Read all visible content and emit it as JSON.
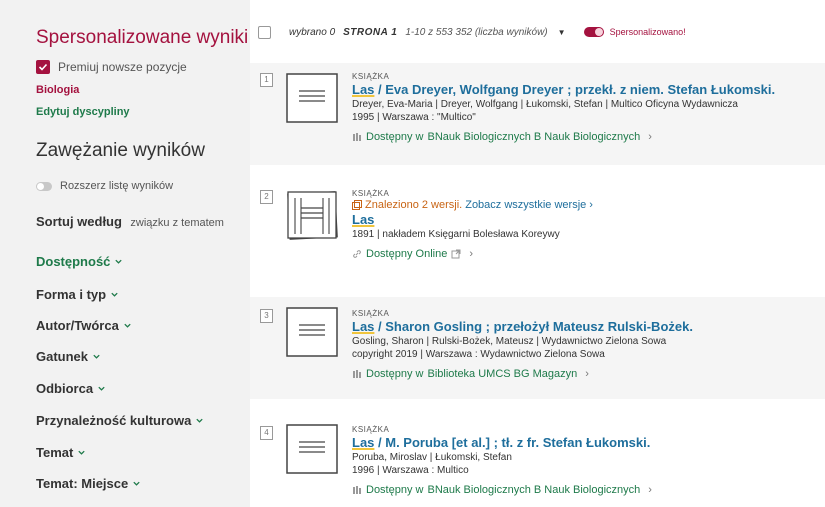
{
  "sidebar": {
    "personalized_title": "Spersonalizowane wyniki",
    "reward_new_label": "Premiuj nowsze pozycje",
    "discipline_selected": "Biologia",
    "edit_disciplines_label": "Edytuj dyscypliny",
    "narrow_title": "Zawężanie wyników",
    "expand_list_label": "Rozszerz listę wyników",
    "sort_label": "Sortuj według",
    "sort_value": "związku z tematem",
    "facets": [
      {
        "label": "Dostępność"
      },
      {
        "label": "Forma i typ"
      },
      {
        "label": "Autor/Twórca"
      },
      {
        "label": "Gatunek"
      },
      {
        "label": "Odbiorca"
      },
      {
        "label": "Przynależność kulturowa"
      },
      {
        "label": "Temat"
      },
      {
        "label": "Temat: Miejsce"
      }
    ]
  },
  "toolbar": {
    "selected": "wybrano 0",
    "page": "STRONA 1",
    "range": "1-10 z 553 352 (liczba wyników)",
    "personalized_label": "Spersonalizowano!"
  },
  "results": [
    {
      "number": "1",
      "type": "KSIĄŻKA",
      "title_first": "Las",
      "title_rest": " / Eva Dreyer, Wolfgang Dreyer ; przekł. z niem. Stefan Łukomski.",
      "authors": "Dreyer, Eva-Maria | Dreyer, Wolfgang | Łukomski, Stefan | Multico Oficyna Wydawnicza",
      "publication": "1995 | Warszawa : \"Multico\"",
      "availability": "Dostępny w",
      "location": "BNauk Biologicznych  B Nauk Biologicznych",
      "icon": "book-icon"
    },
    {
      "number": "2",
      "type": "KSIĄŻKA",
      "versions_found": "Znaleziono 2 wersji.",
      "versions_link": "Zobacz wszystkie wersje",
      "title_first": "Las",
      "title_rest": "",
      "publication": "1891 | nakładem Księgarni Bolesława Koreywy",
      "availability": "Dostępny Online",
      "icon": "multiple-versions-icon"
    },
    {
      "number": "3",
      "type": "KSIĄŻKA",
      "title_first": "Las",
      "title_rest": " / Sharon Gosling ; przełożył Mateusz Rulski-Bożek.",
      "authors": "Gosling, Sharon | Rulski-Bożek, Mateusz | Wydawnictwo Zielona Sowa",
      "publication": "copyright 2019 | Warszawa : Wydawnictwo Zielona Sowa",
      "availability": "Dostępny w",
      "location": "Biblioteka UMCS  BG Magazyn",
      "icon": "book-icon"
    },
    {
      "number": "4",
      "type": "KSIĄŻKA",
      "title_first": "Las",
      "title_rest": " / M. Poruba [et al.] ; tł. z fr. Stefan Łukomski.",
      "authors": "Poruba, Miroslav | Łukomski, Stefan",
      "publication": "1996 | Warszawa : Multico",
      "availability": "Dostępny w",
      "location": "BNauk Biologicznych  B Nauk Biologicznych",
      "icon": "book-icon"
    }
  ],
  "colors": {
    "brand": "#a4123f",
    "green": "#1e7a4a",
    "link": "#1e6e9c",
    "orange": "#c86414"
  }
}
